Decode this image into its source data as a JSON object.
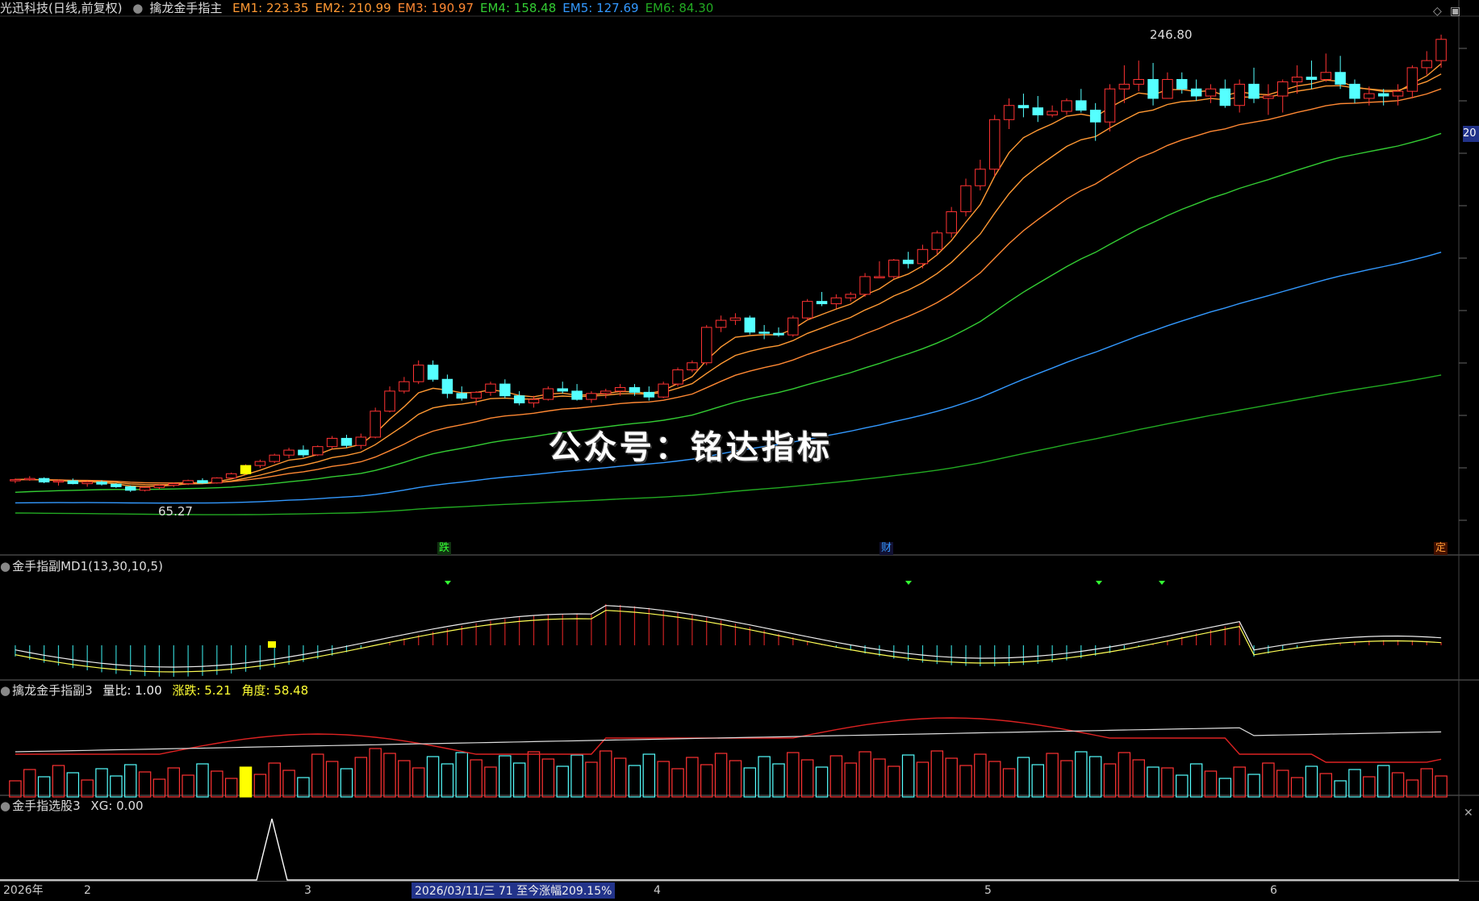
{
  "header": {
    "stock_title": "光迅科技(日线,前复权)",
    "indicator_name": "擒龙金手指主",
    "em": [
      {
        "label": "EM1: 223.35",
        "color": "#ff9933"
      },
      {
        "label": "EM2: 210.99",
        "color": "#ff9933"
      },
      {
        "label": "EM3: 190.97",
        "color": "#ff8833"
      },
      {
        "label": "EM4: 158.48",
        "color": "#33cc33"
      },
      {
        "label": "EM5: 127.69",
        "color": "#3399ff"
      },
      {
        "label": "EM6: 84.30",
        "color": "#22aa22"
      }
    ]
  },
  "main_chart": {
    "high_label": "246.80",
    "low_label": "65.27",
    "price_tag": "20",
    "marks": {
      "die": "跌",
      "cai": "财",
      "ding": "定"
    }
  },
  "panel2": {
    "title": "金手指副MD1(13,30,10,5)"
  },
  "panel3": {
    "title": "擒龙金手指副3",
    "liangbi": "量比: 1.00",
    "zhangdie": "涨跌: 5.21",
    "jiaodu": "角度: 58.48"
  },
  "panel4": {
    "title": "金手指选股3",
    "xg": "XG: 0.00"
  },
  "status_bar": {
    "year": "2026年",
    "months": [
      "2",
      "3",
      "4",
      "5",
      "6"
    ],
    "date_tip": "2026/03/11/三 71 至今涨幅209.15%"
  },
  "watermark": "公众号：铭达指标",
  "colors": {
    "up": "#ff3333",
    "down": "#55ffff",
    "bg": "#000000"
  },
  "chart_data": {
    "type": "candlestick",
    "ylim": [
      55,
      260
    ],
    "candles": [
      [
        70,
        71,
        69,
        70.5
      ],
      [
        70.5,
        72,
        70,
        71
      ],
      [
        71,
        71.5,
        69,
        69.5
      ],
      [
        69.5,
        70.5,
        68,
        70
      ],
      [
        70,
        71,
        68.5,
        68.8
      ],
      [
        68.8,
        70,
        67.5,
        69.5
      ],
      [
        69.5,
        70.2,
        68,
        68.6
      ],
      [
        68.6,
        69,
        67,
        67.5
      ],
      [
        67.5,
        68,
        65.3,
        66
      ],
      [
        66,
        67.5,
        65.5,
        67.2
      ],
      [
        67.2,
        68.5,
        66.5,
        68.1
      ],
      [
        68.1,
        69.2,
        67.4,
        68.8
      ],
      [
        68.8,
        70.5,
        68.2,
        70.1
      ],
      [
        70.1,
        71.1,
        68.8,
        69.1
      ],
      [
        69.1,
        71.5,
        68.8,
        71.2
      ],
      [
        71.2,
        73.5,
        70.8,
        73
      ],
      [
        73,
        77,
        72.5,
        76.5
      ],
      [
        76.5,
        79,
        75.5,
        78.2
      ],
      [
        78.2,
        81.5,
        77.5,
        80.9
      ],
      [
        80.9,
        84,
        79.5,
        83
      ],
      [
        83,
        85,
        80,
        81
      ],
      [
        81,
        85,
        80.5,
        84.5
      ],
      [
        84.5,
        89,
        83.5,
        88
      ],
      [
        88,
        89.5,
        84,
        85
      ],
      [
        85,
        90,
        83.5,
        88.5
      ],
      [
        88.5,
        101,
        88,
        99.5
      ],
      [
        99.5,
        110,
        99,
        108
      ],
      [
        108,
        114,
        107,
        112
      ],
      [
        112,
        121,
        111,
        119
      ],
      [
        119,
        121,
        112,
        113
      ],
      [
        113,
        115,
        105,
        107
      ],
      [
        107,
        110,
        104,
        105
      ],
      [
        105,
        108,
        102,
        107.5
      ],
      [
        107.5,
        112,
        106,
        111
      ],
      [
        111,
        113,
        105,
        106
      ],
      [
        106,
        108,
        102,
        103
      ],
      [
        103,
        106,
        101,
        104.5
      ],
      [
        104.5,
        110,
        104,
        109
      ],
      [
        109,
        112,
        107,
        108
      ],
      [
        108,
        111,
        104,
        104.5
      ],
      [
        104.5,
        108,
        103,
        107
      ],
      [
        107,
        109,
        105,
        108
      ],
      [
        108,
        111,
        106,
        109.5
      ],
      [
        109.5,
        111,
        106,
        107.5
      ],
      [
        107.5,
        110,
        104,
        105.5
      ],
      [
        105.5,
        112,
        105,
        111
      ],
      [
        111,
        118,
        110,
        117
      ],
      [
        117,
        121,
        116,
        120
      ],
      [
        120,
        136,
        119,
        135
      ],
      [
        135,
        140,
        133,
        138
      ],
      [
        138,
        141,
        136,
        139
      ],
      [
        139,
        140,
        132,
        133
      ],
      [
        133,
        136,
        130,
        132.5
      ],
      [
        132.5,
        135,
        131,
        131.8
      ],
      [
        131.8,
        140,
        131,
        139
      ],
      [
        139,
        147,
        138,
        146
      ],
      [
        146,
        150,
        144,
        145
      ],
      [
        145,
        149,
        143,
        147.5
      ],
      [
        147.5,
        150,
        146,
        149
      ],
      [
        149,
        158,
        148,
        156.5
      ],
      [
        156.5,
        163,
        156,
        156.5
      ],
      [
        156.5,
        164,
        155.5,
        163.5
      ],
      [
        163.5,
        167,
        160,
        162
      ],
      [
        162,
        170,
        160,
        168
      ],
      [
        168,
        176,
        166,
        175
      ],
      [
        175,
        186,
        173,
        184
      ],
      [
        184,
        198,
        182,
        195
      ],
      [
        195,
        206,
        193,
        202
      ],
      [
        202,
        225,
        199,
        223
      ],
      [
        223,
        232,
        219,
        229
      ],
      [
        229,
        234,
        224,
        228
      ],
      [
        228,
        233,
        222,
        225
      ],
      [
        225,
        229,
        224,
        226.5
      ],
      [
        226.5,
        232,
        225,
        231
      ],
      [
        231,
        236,
        226,
        227
      ],
      [
        227,
        230,
        214,
        222
      ],
      [
        222,
        238,
        218,
        236
      ],
      [
        236,
        246,
        230,
        238
      ],
      [
        238,
        248,
        235,
        240
      ],
      [
        240,
        247,
        229,
        232
      ],
      [
        232,
        243,
        236,
        240
      ],
      [
        240,
        243,
        234,
        236
      ],
      [
        236,
        240,
        231,
        233
      ],
      [
        233,
        238,
        230,
        236
      ],
      [
        236,
        240,
        228,
        229
      ],
      [
        229,
        240,
        226,
        238
      ],
      [
        238,
        245,
        230,
        232
      ],
      [
        232,
        238,
        225,
        233
      ],
      [
        233,
        240,
        226,
        239
      ],
      [
        239,
        246,
        234,
        241
      ],
      [
        241,
        248,
        236,
        240
      ],
      [
        240,
        251,
        239,
        243
      ],
      [
        243,
        250,
        236,
        238
      ],
      [
        238,
        240,
        230,
        232
      ],
      [
        232,
        237,
        229,
        234
      ],
      [
        234,
        236,
        229,
        233
      ],
      [
        233,
        238,
        229,
        235
      ],
      [
        235,
        246,
        232,
        245
      ],
      [
        245,
        252,
        242,
        248
      ],
      [
        248,
        259,
        245,
        257
      ]
    ],
    "ema_lines": [
      {
        "name": "EM1",
        "color": "#ff9933"
      },
      {
        "name": "EM2",
        "color": "#ff9933"
      },
      {
        "name": "EM3",
        "color": "#ff8833"
      },
      {
        "name": "EM4",
        "color": "#33cc33"
      },
      {
        "name": "EM5",
        "color": "#3399ff"
      },
      {
        "name": "EM6",
        "color": "#22aa22"
      }
    ]
  }
}
